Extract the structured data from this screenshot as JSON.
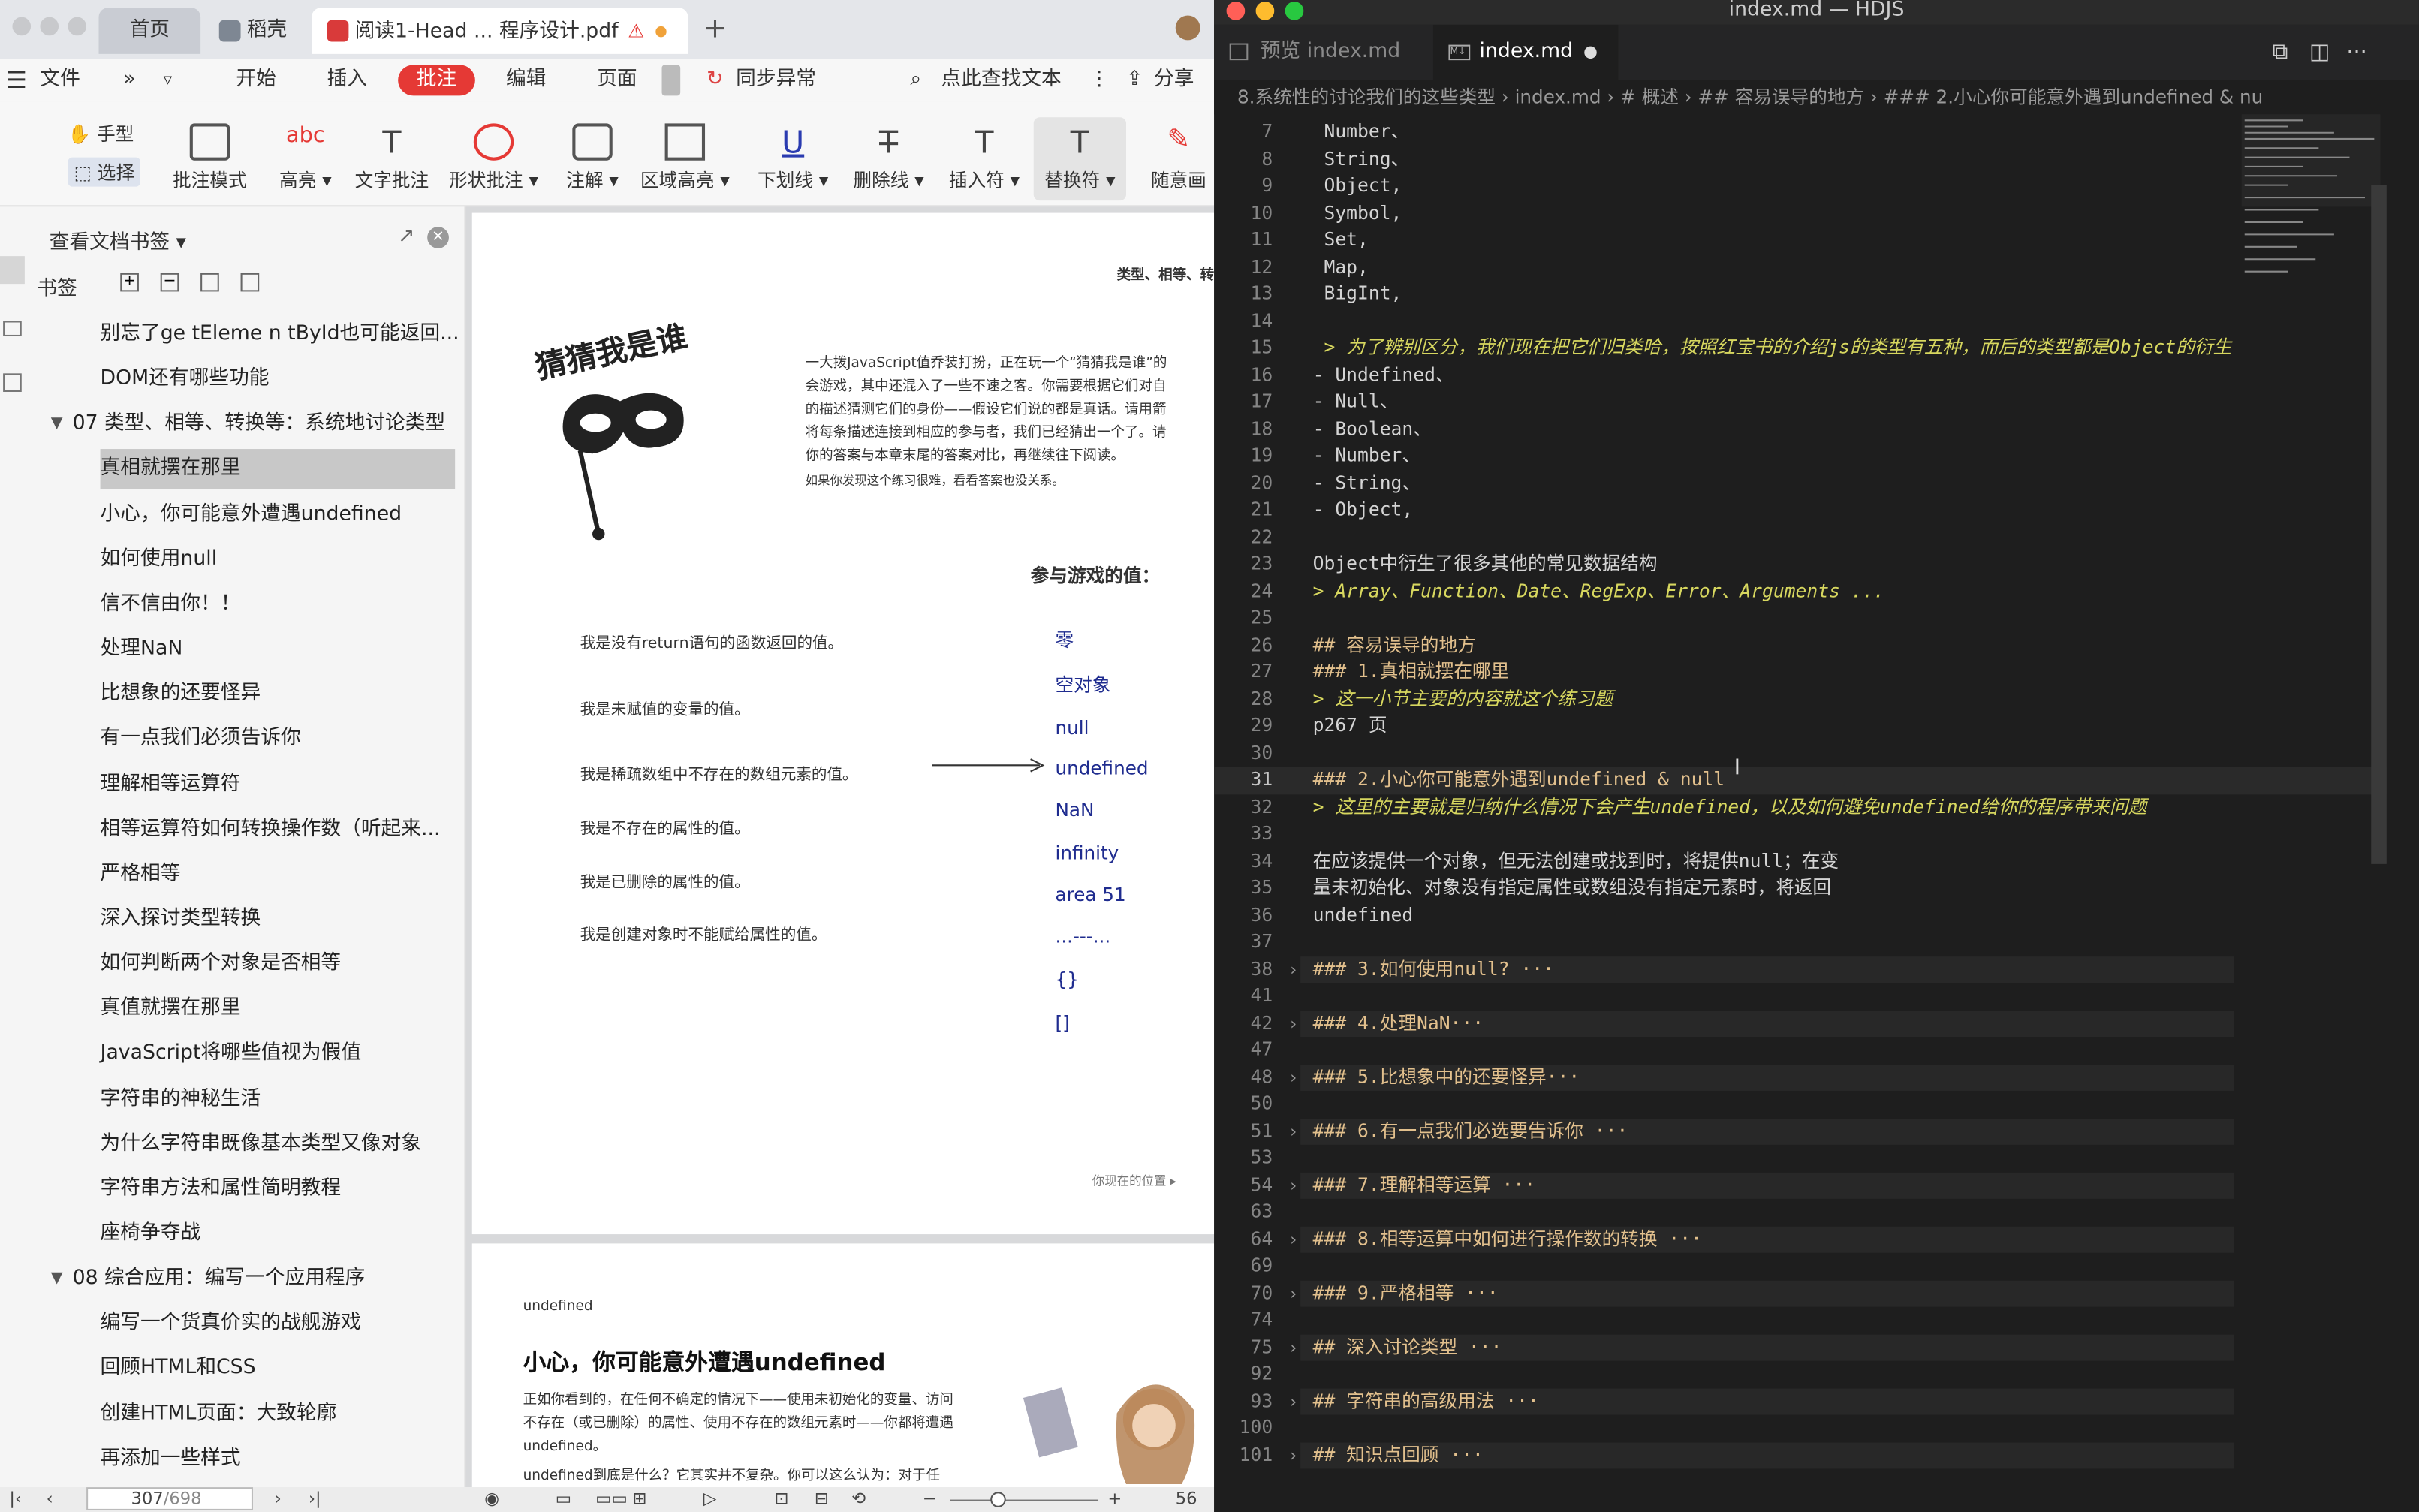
{
  "pdf": {
    "tabs": {
      "home": "首页",
      "shell": "稻壳",
      "doc": "阅读1-Head ... 程序设计.pdf",
      "new": "+"
    },
    "menu": {
      "file": "文件",
      "more": "»",
      "start": "开始",
      "insert": "插入",
      "annotate": "批注",
      "edit": "编辑",
      "page": "页面",
      "sync": "同步异常",
      "search": "点此查找文本",
      "share": "分享"
    },
    "tools": {
      "hand": "手型",
      "select": "选择",
      "annot_mode": "批注模式",
      "highlight": "高亮",
      "text_annot": "文字批注",
      "shape_annot": "形状批注",
      "note": "注解",
      "area_highlight": "区域高亮",
      "underline": "下划线",
      "strike": "删除线",
      "insert_mark": "插入符",
      "replace_mark": "替换符",
      "freehand": "随意画"
    },
    "sidebar": {
      "title": "查看文档书签",
      "label": "书签",
      "items": [
        "别忘了ge tEleme n tById也可能返回...",
        "DOM还有哪些功能",
        "07 类型、相等、转换等：系统地讨论类型",
        "真相就摆在那里",
        "小心，你可能意外遭遇undefined",
        "如何使用null",
        "信不信由你！！",
        "处理NaN",
        "比想象的还要怪异",
        "有一点我们必须告诉你",
        "理解相等运算符",
        "相等运算符如何转换操作数（听起来...",
        "严格相等",
        "深入探讨类型转换",
        "如何判断两个对象是否相等",
        "真值就摆在那里",
        "JavaScript将哪些值视为假值",
        "字符串的神秘生活",
        "为什么字符串既像基本类型又像对象",
        "字符串方法和属性简明教程",
        "座椅争夺战",
        "08 综合应用：编写一个应用程序",
        "编写一个货真价实的战舰游戏",
        "回顾HTML和CSS",
        "创建HTML页面：大致轮廓",
        "再添加一些样式"
      ]
    },
    "page1": {
      "header": "类型、相等、转",
      "title": "猜猜我是谁",
      "intro1": "一大拨JavaScript值乔装打扮，正在玩一个“猜猜我是谁”的",
      "intro2": "会游戏，其中还混入了一些不速之客。你需要根据它们对自",
      "intro3": "的描述猜测它们的身份——假设它们说的都是真话。请用箭",
      "intro4": "将每条描述连接到相应的参与者，我们已经猜出一个了。请",
      "intro5": "你的答案与本章末尾的答案对比，再继续往下阅读。",
      "hint": "如果你发现这个练习很难，看看答案也没关系。",
      "players_title": "参与游戏的值：",
      "clues": [
        "我是没有return语句的函数返回的值。",
        "我是未赋值的变量的值。",
        "我是稀疏数组中不存在的数组元素的值。",
        "我是不存在的属性的值。",
        "我是已删除的属性的值。",
        "我是创建对象时不能赋给属性的值。"
      ],
      "values": [
        "零",
        "空对象",
        "null",
        "undefined",
        "NaN",
        "infinity",
        "area 51",
        "...---...",
        "{}",
        "[]"
      ],
      "footer": "你现在的位置 ▸"
    },
    "page2": {
      "tag": "undefined",
      "title": "小心，你可能意外遭遇undefined",
      "p1": "正如你看到的，在任何不确定的情况下——使用未初始化的变量、访问",
      "p2": "不存在（或已删除）的属性、使用不存在的数组元素时——你都将遭遇",
      "p3": "undefined。",
      "p4": "undefined到底是什么？它其实并不复杂。你可以这么认为：对于任"
    },
    "status": {
      "page_current": "307",
      "page_total": "/698",
      "zoom": "56"
    }
  },
  "editor": {
    "window_title": "index.md — HDJS",
    "tabs": {
      "preview": "预览 index.md",
      "active": "index.md"
    },
    "breadcrumb": "8.系统性的讨论我们的这些类型 ›  index.md ›  # 概述 ›  ## 容易误导的地方 ›  ### 2.小心你可能意外遇到undefined & nu",
    "lines": [
      {
        "n": "7",
        "t": " Number、",
        "k": ""
      },
      {
        "n": "8",
        "t": " String、",
        "k": ""
      },
      {
        "n": "9",
        "t": " Object,",
        "k": ""
      },
      {
        "n": "10",
        "t": " Symbol,",
        "k": ""
      },
      {
        "n": "11",
        "t": " Set,",
        "k": ""
      },
      {
        "n": "12",
        "t": " Map,",
        "k": ""
      },
      {
        "n": "13",
        "t": " BigInt,",
        "k": ""
      },
      {
        "n": "14",
        "t": "",
        "k": ""
      },
      {
        "n": "15",
        "t": " > 为了辨别区分，我们现在把它们归类哈，按照红宝书的介绍js的类型有五种，而后的类型都是Object的衍生",
        "k": "q"
      },
      {
        "n": "16",
        "t": "- Undefined、",
        "k": ""
      },
      {
        "n": "17",
        "t": "- Null、",
        "k": ""
      },
      {
        "n": "18",
        "t": "- Boolean、",
        "k": ""
      },
      {
        "n": "19",
        "t": "- Number、",
        "k": ""
      },
      {
        "n": "20",
        "t": "- String、",
        "k": ""
      },
      {
        "n": "21",
        "t": "- Object,",
        "k": ""
      },
      {
        "n": "22",
        "t": "",
        "k": ""
      },
      {
        "n": "23",
        "t": "Object中衍生了很多其他的常见数据结构",
        "k": ""
      },
      {
        "n": "24",
        "t": "> Array、Function、Date、RegExp、Error、Arguments ...",
        "k": "q"
      },
      {
        "n": "25",
        "t": "",
        "k": ""
      },
      {
        "n": "26",
        "t": "## 容易误导的地方",
        "k": "h"
      },
      {
        "n": "27",
        "t": "### 1.真相就摆在哪里",
        "k": "h"
      },
      {
        "n": "28",
        "t": "> 这一小节主要的内容就这个练习题",
        "k": "q"
      },
      {
        "n": "29",
        "t": "p267 页",
        "k": ""
      },
      {
        "n": "30",
        "t": "",
        "k": ""
      },
      {
        "n": "31",
        "t": "### 2.小心你可能意外遇到undefined & null",
        "k": "h"
      },
      {
        "n": "32",
        "t": "> 这里的主要就是归纳什么情况下会产生undefined，以及如何避免undefined给你的程序带来问题",
        "k": "q"
      },
      {
        "n": "33",
        "t": "",
        "k": ""
      },
      {
        "n": "34",
        "t": "在应该提供一个对象，但无法创建或找到时，将提供null；在变",
        "k": ""
      },
      {
        "n": "35",
        "t": "量未初始化、对象没有指定属性或数组没有指定元素时，将返回",
        "k": ""
      },
      {
        "n": "36",
        "t": "undefined",
        "k": ""
      },
      {
        "n": "37",
        "t": "",
        "k": ""
      },
      {
        "n": "38",
        "t": "### 3.如何使用null? ···",
        "k": "f"
      },
      {
        "n": "41",
        "t": "",
        "k": ""
      },
      {
        "n": "42",
        "t": "### 4.处理NaN···",
        "k": "f"
      },
      {
        "n": "47",
        "t": "",
        "k": ""
      },
      {
        "n": "48",
        "t": "### 5.比想象中的还要怪异···",
        "k": "f"
      },
      {
        "n": "50",
        "t": "",
        "k": ""
      },
      {
        "n": "51",
        "t": "### 6.有一点我们必选要告诉你 ···",
        "k": "f"
      },
      {
        "n": "53",
        "t": "",
        "k": ""
      },
      {
        "n": "54",
        "t": "### 7.理解相等运算 ···",
        "k": "f"
      },
      {
        "n": "63",
        "t": "",
        "k": ""
      },
      {
        "n": "64",
        "t": "### 8.相等运算中如何进行操作数的转换 ···",
        "k": "f"
      },
      {
        "n": "69",
        "t": "",
        "k": ""
      },
      {
        "n": "70",
        "t": "### 9.严格相等 ···",
        "k": "f"
      },
      {
        "n": "74",
        "t": "",
        "k": ""
      },
      {
        "n": "75",
        "t": "## 深入讨论类型 ···",
        "k": "f"
      },
      {
        "n": "92",
        "t": "",
        "k": ""
      },
      {
        "n": "93",
        "t": "## 字符串的高级用法 ···",
        "k": "f"
      },
      {
        "n": "100",
        "t": "",
        "k": ""
      },
      {
        "n": "101",
        "t": "## 知识点回顾 ···",
        "k": "f"
      }
    ]
  },
  "colors": {
    "accent_red": "#e53935",
    "editor_bg": "#1e1e1e",
    "heading": "#e2c08d",
    "quote": "#d7d75f"
  }
}
